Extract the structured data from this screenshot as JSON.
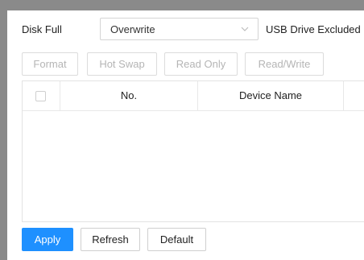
{
  "disk_full": {
    "label": "Disk Full",
    "selected": "Overwrite",
    "icon": "chevron-down-icon"
  },
  "usb_label": "USB Drive Excluded",
  "toolbar": {
    "format": "Format",
    "hot_swap": "Hot Swap",
    "read_only": "Read Only",
    "read_write": "Read/Write"
  },
  "table": {
    "headers": [
      "No.",
      "Device Name"
    ],
    "rows": []
  },
  "actions": {
    "apply": "Apply",
    "refresh": "Refresh",
    "default": "Default"
  },
  "colors": {
    "accent": "#1e90ff",
    "disabled_text": "#b5b5b5",
    "frame": "#8a8a8a"
  }
}
